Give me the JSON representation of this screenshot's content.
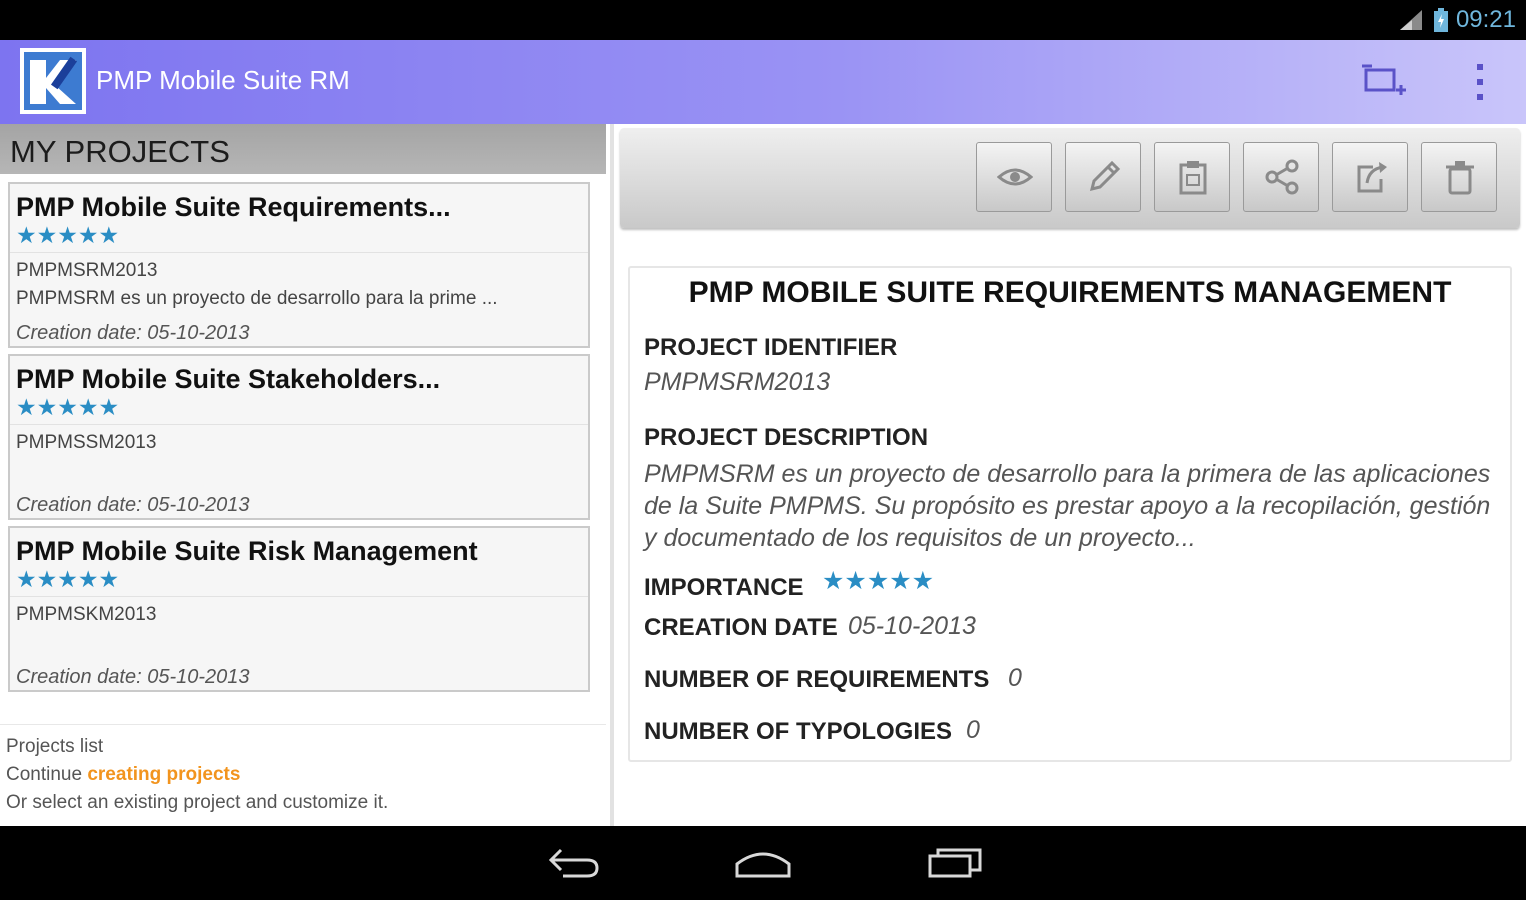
{
  "status_bar": {
    "time": "09:21",
    "signal_icon": "signal-icon",
    "battery_icon": "battery-icon"
  },
  "action_bar": {
    "title": "PMP Mobile Suite RM",
    "logo_icon": "app-logo-icon",
    "actions": [
      {
        "name": "new-project",
        "icon": "new-project-icon"
      },
      {
        "name": "overflow-menu",
        "icon": "overflow-menu-icon"
      }
    ]
  },
  "projects": {
    "header": "MY PROJECTS",
    "items": [
      {
        "title": "PMP Mobile Suite Requirements...",
        "importance": 5,
        "id": "PMPMSRM2013",
        "description": "PMPMSRM es un proyecto de desarrollo para la prime ...",
        "creation_date": "Creation date: 05-10-2013"
      },
      {
        "title": "PMP Mobile Suite Stakeholders...",
        "importance": 5,
        "id": "PMPMSSM2013",
        "description": "",
        "creation_date": "Creation date: 05-10-2013"
      },
      {
        "title": "PMP Mobile Suite Risk Management",
        "importance": 5,
        "id": "PMPMSKM2013",
        "description": "",
        "creation_date": "Creation date: 05-10-2013"
      }
    ],
    "footer": {
      "line1": "Projects list",
      "line2_prefix": "Continue",
      "line2_link": "creating projects",
      "line3": "Or select an existing project and customize it."
    }
  },
  "toolbar": {
    "buttons": [
      {
        "name": "view",
        "icon": "eye-icon"
      },
      {
        "name": "edit",
        "icon": "pencil-icon"
      },
      {
        "name": "report",
        "icon": "clipboard-icon"
      },
      {
        "name": "share",
        "icon": "share-icon"
      },
      {
        "name": "export",
        "icon": "export-icon"
      },
      {
        "name": "delete",
        "icon": "trash-icon"
      }
    ]
  },
  "detail": {
    "title": "PMP MOBILE SUITE REQUIREMENTS MANAGEMENT",
    "identifier_label": "PROJECT IDENTIFIER",
    "identifier_value": "PMPMSRM2013",
    "description_label": "PROJECT DESCRIPTION",
    "description_value": "PMPMSRM es un proyecto de desarrollo para la primera de las aplicaciones de la Suite PMPMS. Su propósito es prestar apoyo a la recopilación, gestión y documentado de los requisitos de un proyecto...",
    "importance_label": "IMPORTANCE",
    "importance_value": 5,
    "creation_label": "CREATION DATE",
    "creation_value": "05-10-2013",
    "requirements_label": "NUMBER OF REQUIREMENTS",
    "requirements_value": "0",
    "typologies_label": "NUMBER OF TYPOLOGIES",
    "typologies_value": "0"
  },
  "nav_bar": {
    "buttons": [
      {
        "name": "back",
        "icon": "back-icon"
      },
      {
        "name": "home",
        "icon": "home-icon"
      },
      {
        "name": "recents",
        "icon": "recent-apps-icon"
      }
    ]
  },
  "colors": {
    "accent": "#2a8dc4",
    "action_bar_start": "#7d74f0",
    "action_bar_end": "#c9c5fa",
    "link": "#f2941e"
  }
}
